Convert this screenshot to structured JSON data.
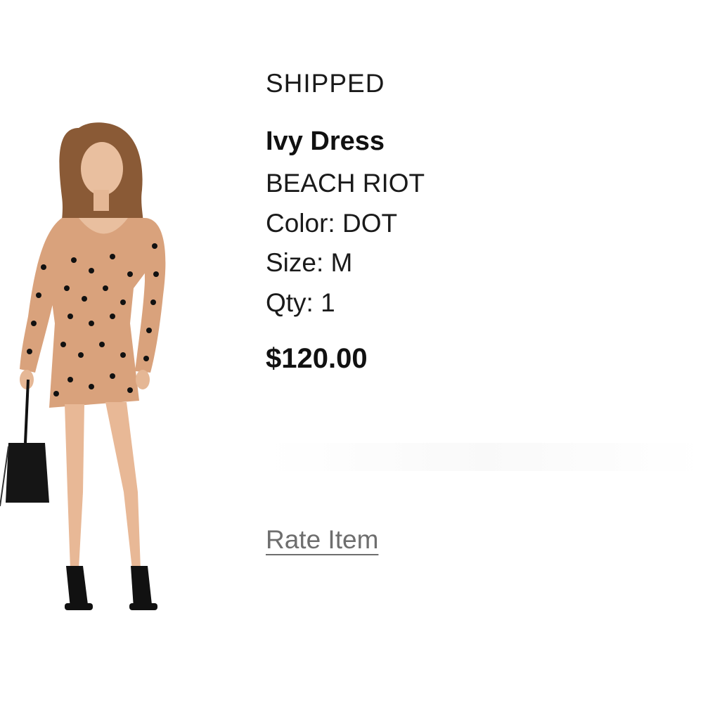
{
  "order_item": {
    "status": "SHIPPED",
    "name": "Ivy Dress",
    "brand": "BEACH RIOT",
    "color_line": "Color: DOT",
    "size_line": "Size: M",
    "qty_line": "Qty: 1",
    "price": "$120.00",
    "rate_link": "Rate Item"
  },
  "colors": {
    "dress": "#d9a27c",
    "dots": "#111111",
    "link": "#6e6e6e"
  }
}
